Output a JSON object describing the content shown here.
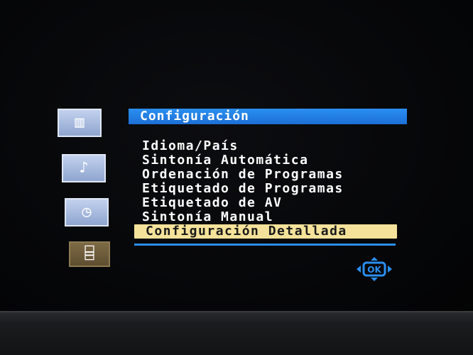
{
  "colors": {
    "title_bar": "#2b8ff0",
    "selected_item": "#f4e29a",
    "side_icon": "#a9bce2",
    "side_icon_selected": "#6d5c3a",
    "nav_icon": "#2b8ff0"
  },
  "sidebar": {
    "items": [
      {
        "icon": "picture-icon",
        "glyph": "▥",
        "selected": false
      },
      {
        "icon": "music-note-icon",
        "glyph": "♪",
        "selected": false
      },
      {
        "icon": "clock-icon",
        "glyph": "◷",
        "selected": false
      },
      {
        "icon": "toolbox-icon",
        "glyph": "⌸",
        "selected": true
      }
    ]
  },
  "menu": {
    "title": "Configuración",
    "items": [
      "Idioma/País",
      "Sintonía Automática",
      "Ordenación de Programas",
      "Etiquetado de Programas",
      "Etiquetado de AV",
      "Sintonía Manual",
      "Configuración Detallada"
    ],
    "selected_index": 6
  },
  "nav": {
    "ok_label": "OK",
    "icon": "dpad-ok-icon"
  }
}
